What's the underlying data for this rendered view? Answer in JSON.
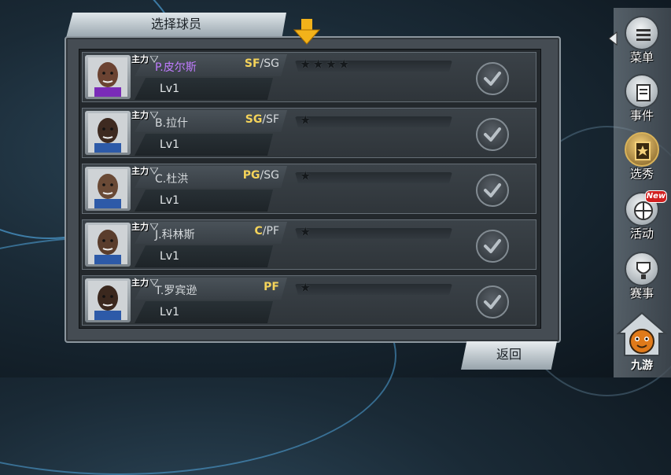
{
  "panel": {
    "title": "选择球员"
  },
  "players": [
    {
      "badge": "主力",
      "name": "P.皮尔斯",
      "pos_main": "SF",
      "pos_alt": "/SG",
      "level": "Lv1",
      "stars": 4,
      "elite": true
    },
    {
      "badge": "主力",
      "name": "B.拉什",
      "pos_main": "SG",
      "pos_alt": "/SF",
      "level": "Lv1",
      "stars": 1,
      "elite": false
    },
    {
      "badge": "主力",
      "name": "C.杜洪",
      "pos_main": "PG",
      "pos_alt": "/SG",
      "level": "Lv1",
      "stars": 1,
      "elite": false
    },
    {
      "badge": "主力",
      "name": "J.科林斯",
      "pos_main": "C",
      "pos_alt": "/PF",
      "level": "Lv1",
      "stars": 1,
      "elite": false
    },
    {
      "badge": "主力",
      "name": "T.罗宾逊",
      "pos_main": "PF",
      "pos_alt": "",
      "level": "Lv1",
      "stars": 1,
      "elite": false
    }
  ],
  "footer": {
    "back_label": "返回"
  },
  "sidebar": {
    "items": [
      {
        "label": "菜单",
        "icon": "menu-icon"
      },
      {
        "label": "事件",
        "icon": "event-icon"
      },
      {
        "label": "选秀",
        "icon": "draft-icon",
        "active": true
      },
      {
        "label": "活动",
        "icon": "activity-icon",
        "badge": "New"
      },
      {
        "label": "赛事",
        "icon": "tournament-icon"
      }
    ],
    "home_label": "九游"
  },
  "colors": {
    "accent": "#f4d35a",
    "elite_name": "#c07cff",
    "arrow": "#f2b21a"
  }
}
